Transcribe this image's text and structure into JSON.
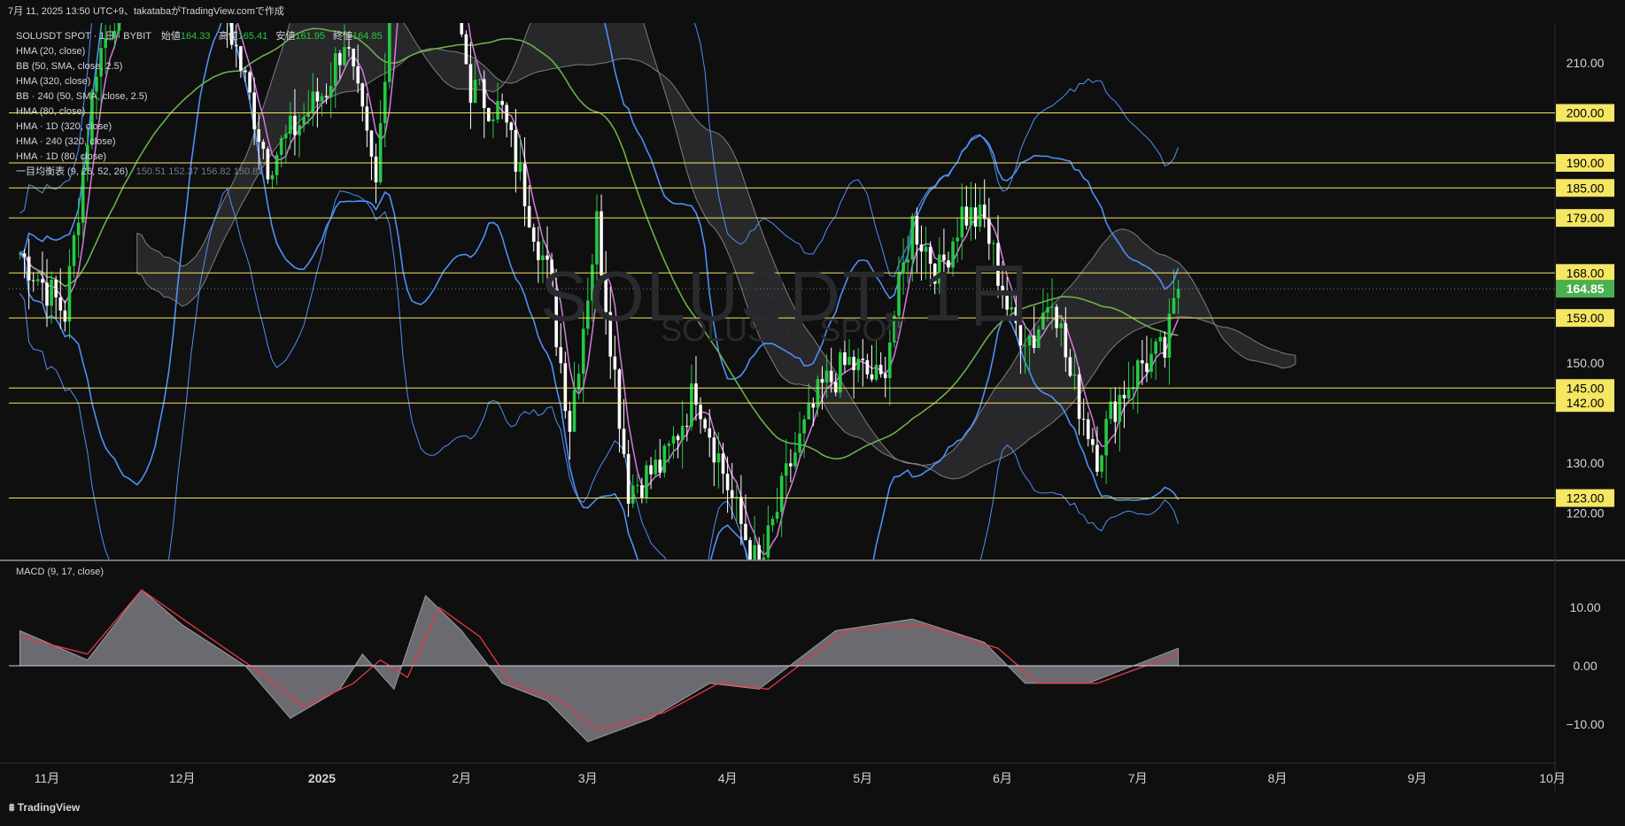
{
  "header": {
    "caption": "7月 11, 2025 13:50 UTC+9、takatabaがTradingView.comで作成"
  },
  "watermark": {
    "symbol": "SOLUSDT, 1日",
    "sub": "SOLUSDT SPOT"
  },
  "legend": {
    "symbol_line": "SOLUSDT SPOT · 1日 · BYBIT",
    "ohlc": [
      {
        "label": "始値",
        "value": "164.33"
      },
      {
        "label": "高値",
        "value": "165.41"
      },
      {
        "label": "安値",
        "value": "161.95"
      },
      {
        "label": "終値",
        "value": "164.85"
      }
    ],
    "indicators": [
      "HMA (20, close)",
      "BB (50, SMA, close, 2.5)",
      "HMA (320, close)",
      "BB · 240 (50, SMA, close, 2.5)",
      "HMA (80, close)",
      "HMA · 1D (320, close)",
      "HMA · 240 (320, close)",
      "HMA · 1D (80, close)"
    ],
    "ichimoku": {
      "label": "一目均衡表 (9, 26, 52, 26)",
      "values": "150.51  152.37  156.82  150.81"
    }
  },
  "macd_label": "MACD (9, 17, close)",
  "footer": {
    "logo": "TradingView"
  },
  "colors": {
    "background": "#0f0f0f",
    "up": "#26c943",
    "down": "#ffffff",
    "hline": "#f5e663",
    "hma_fast": "#d679e0",
    "hma_slow": "#6ab04c",
    "bb_blue": "#4f8ff7",
    "cloud": "#2b2b2e",
    "macd_signal": "#e63946",
    "price_tag": "#4caf50"
  },
  "chart_data": [
    {
      "type": "candlestick",
      "title": "SOLUSDT SPOT · 1日 · BYBIT",
      "x_tick_labels": [
        "11月",
        "12月",
        "2025",
        "2月",
        "3月",
        "4月",
        "5月",
        "6月",
        "7月",
        "8月",
        "9月",
        "10月"
      ],
      "y_tick_labels": [
        "210.00",
        "150.00",
        "130.00",
        "120.00"
      ],
      "ylim": [
        112,
        215
      ],
      "horizontal_levels": [
        200,
        190,
        185,
        179,
        168,
        159,
        145,
        142,
        123
      ],
      "horizontal_level_labels": [
        "200.00",
        "190.00",
        "185.00",
        "179.00",
        "168.00",
        "159.00",
        "145.00",
        "142.00",
        "123.00"
      ],
      "last_price": 164.85,
      "last_price_label": "164.85",
      "price_path": [
        [
          "2024-10-26",
          172
        ],
        [
          "2024-11-05",
          160
        ],
        [
          "2024-11-12",
          210
        ],
        [
          "2024-11-22",
          235
        ],
        [
          "2024-12-06",
          235
        ],
        [
          "2024-12-20",
          190
        ],
        [
          "2025-01-02",
          205
        ],
        [
          "2025-01-06",
          215
        ],
        [
          "2025-01-13",
          185
        ],
        [
          "2025-01-19",
          260
        ],
        [
          "2025-01-28",
          235
        ],
        [
          "2025-02-03",
          205
        ],
        [
          "2025-02-10",
          200
        ],
        [
          "2025-02-20",
          168
        ],
        [
          "2025-02-25",
          138
        ],
        [
          "2025-03-03",
          178
        ],
        [
          "2025-03-10",
          125
        ],
        [
          "2025-03-18",
          130
        ],
        [
          "2025-03-25",
          145
        ],
        [
          "2025-04-03",
          120
        ],
        [
          "2025-04-08",
          108
        ],
        [
          "2025-04-15",
          130
        ],
        [
          "2025-04-22",
          145
        ],
        [
          "2025-04-28",
          150
        ],
        [
          "2025-05-05",
          146
        ],
        [
          "2025-05-12",
          178
        ],
        [
          "2025-05-18",
          168
        ],
        [
          "2025-05-23",
          180
        ],
        [
          "2025-05-28",
          178
        ],
        [
          "2025-06-03",
          158
        ],
        [
          "2025-06-08",
          155
        ],
        [
          "2025-06-12",
          165
        ],
        [
          "2025-06-16",
          147
        ],
        [
          "2025-06-22",
          132
        ],
        [
          "2025-06-26",
          142
        ],
        [
          "2025-07-02",
          150
        ],
        [
          "2025-07-07",
          152
        ],
        [
          "2025-07-10",
          164.85
        ]
      ]
    },
    {
      "type": "area",
      "title": "MACD (9, 17, close)",
      "y_tick_labels": [
        "10.00",
        "0.00",
        "−10.00"
      ],
      "ylim": [
        -15,
        15
      ],
      "series": [
        {
          "values": [
            [
              "2024-10-26",
              6
            ],
            [
              "2024-11-10",
              1
            ],
            [
              "2024-11-22",
              13
            ],
            [
              "2024-12-01",
              7
            ],
            [
              "2024-12-15",
              0
            ],
            [
              "2024-12-25",
              -9
            ],
            [
              "2025-01-05",
              -4
            ],
            [
              "2025-01-10",
              2
            ],
            [
              "2025-01-17",
              -4
            ],
            [
              "2025-01-24",
              12
            ],
            [
              "2025-02-01",
              6
            ],
            [
              "2025-02-10",
              -3
            ],
            [
              "2025-02-20",
              -6
            ],
            [
              "2025-03-01",
              -13
            ],
            [
              "2025-03-15",
              -9
            ],
            [
              "2025-03-28",
              -3
            ],
            [
              "2025-04-08",
              -4
            ],
            [
              "2025-04-25",
              6
            ],
            [
              "2025-05-12",
              8
            ],
            [
              "2025-05-28",
              4
            ],
            [
              "2025-06-06",
              -3
            ],
            [
              "2025-06-20",
              -3
            ],
            [
              "2025-07-10",
              3
            ]
          ]
        },
        {
          "values": [
            [
              "2024-10-26",
              5
            ],
            [
              "2024-11-10",
              2
            ],
            [
              "2024-11-22",
              13
            ],
            [
              "2024-12-03",
              7
            ],
            [
              "2024-12-18",
              -1
            ],
            [
              "2024-12-28",
              -7
            ],
            [
              "2025-01-08",
              -3
            ],
            [
              "2025-01-14",
              1
            ],
            [
              "2025-01-20",
              -2
            ],
            [
              "2025-01-27",
              10
            ],
            [
              "2025-02-05",
              5
            ],
            [
              "2025-02-12",
              -3
            ],
            [
              "2025-02-23",
              -6
            ],
            [
              "2025-03-03",
              -11
            ],
            [
              "2025-03-18",
              -8
            ],
            [
              "2025-03-30",
              -3
            ],
            [
              "2025-04-10",
              -4
            ],
            [
              "2025-04-27",
              6
            ],
            [
              "2025-05-14",
              7
            ],
            [
              "2025-05-31",
              3
            ],
            [
              "2025-06-09",
              -3
            ],
            [
              "2025-06-22",
              -3
            ],
            [
              "2025-07-10",
              2
            ]
          ]
        }
      ]
    }
  ]
}
